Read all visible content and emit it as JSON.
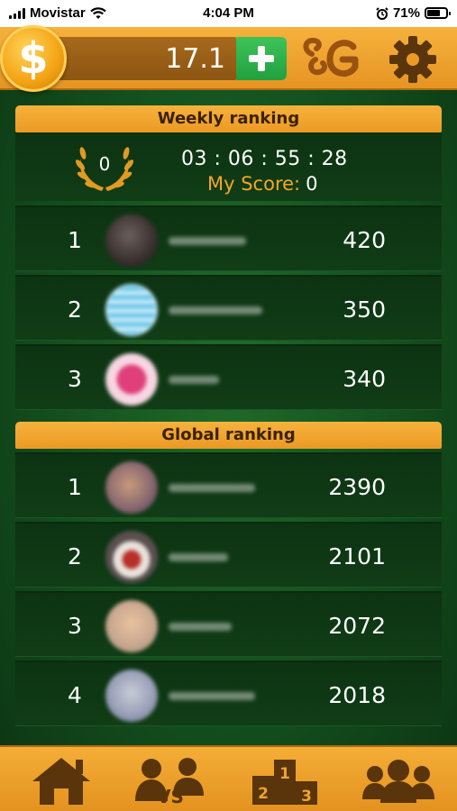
{
  "status_bar": {
    "carrier": "Movistar",
    "time": "4:04 PM",
    "battery": "71%",
    "battery_level": 0.71,
    "icons": [
      "signal-icon",
      "wifi-icon",
      "alarm-icon",
      "battery-icon"
    ]
  },
  "topbar": {
    "coin_symbol": "$",
    "balance": "17.1",
    "add_icon": "plus-icon",
    "logo_icon": "g-logo-icon",
    "settings_icon": "gear-icon"
  },
  "weekly": {
    "title": "Weekly ranking",
    "laurel_value": "0",
    "countdown": "03 : 06 : 55 : 28",
    "my_score_label": "My Score:",
    "my_score_value": "0",
    "rows": [
      {
        "rank": "1",
        "score": "420"
      },
      {
        "rank": "2",
        "score": "350"
      },
      {
        "rank": "3",
        "score": "340"
      }
    ]
  },
  "global": {
    "title": "Global ranking",
    "rows": [
      {
        "rank": "1",
        "score": "2390"
      },
      {
        "rank": "2",
        "score": "2101"
      },
      {
        "rank": "3",
        "score": "2072"
      },
      {
        "rank": "4",
        "score": "2018"
      }
    ]
  },
  "bottom_nav": {
    "items": [
      "home-icon",
      "versus-icon",
      "podium-icon",
      "friends-icon"
    ],
    "podium_labels": [
      "2",
      "1",
      "3"
    ]
  },
  "colors": {
    "accent_orange": "#f5a623",
    "panel_green": "#0d3312",
    "add_green": "#2fb24c"
  }
}
